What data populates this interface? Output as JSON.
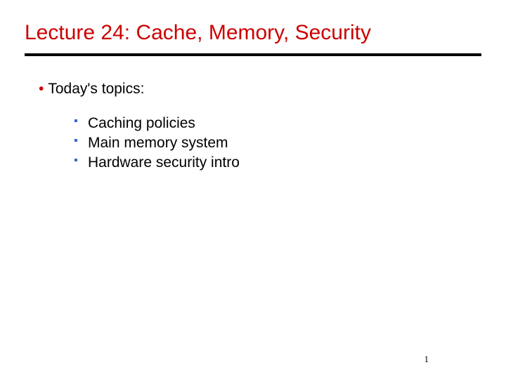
{
  "title": "Lecture 24: Cache, Memory, Security",
  "topicsHeader": "Today's topics:",
  "subtopics": [
    "Caching policies",
    "Main memory system",
    "Hardware security intro"
  ],
  "pageNumber": "1"
}
